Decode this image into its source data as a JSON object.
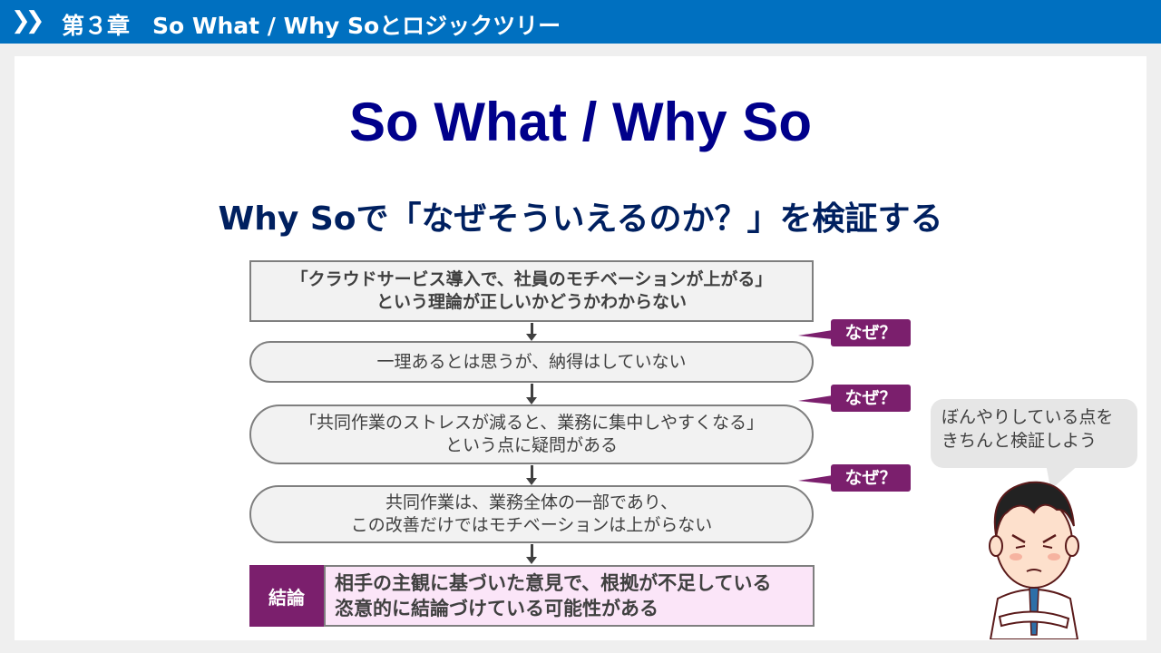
{
  "header": {
    "chevron_icon": "double-chevron-right",
    "title": "第３章　So What / Why Soとロジックツリー"
  },
  "main": {
    "title": "So What / Why So",
    "subtitle": "Why Soで「なぜそういえるのか？」を検証する",
    "steps": [
      {
        "line1": "「クラウドサービス導入で、社員のモチベーションが上がる」",
        "line2": "という理論が正しいかどうかわからない"
      },
      {
        "line1": "一理あるとは思うが、納得はしていない"
      },
      {
        "line1": "「共同作業のストレスが減ると、業務に集中しやすくなる」",
        "line2": "という点に疑問がある"
      },
      {
        "line1": "共同作業は、業務全体の一部であり、",
        "line2": "この改善だけではモチベーションは上がらない"
      }
    ],
    "why_tags": [
      "なぜ？",
      "なぜ？",
      "なぜ？"
    ],
    "conclusion": {
      "label": "結論",
      "line1": "相手の主観に基づいた意見で、根拠が不足している",
      "line2": "恣意的に結論づけている可能性がある"
    },
    "speech": {
      "line1": "ぼんやりしている点を",
      "line2": "きちんと検証しよう"
    }
  },
  "colors": {
    "header": "#0070c0",
    "title": "#00008b",
    "accent": "#7b1f6d",
    "conclusion_bg": "#fbe5f8"
  }
}
